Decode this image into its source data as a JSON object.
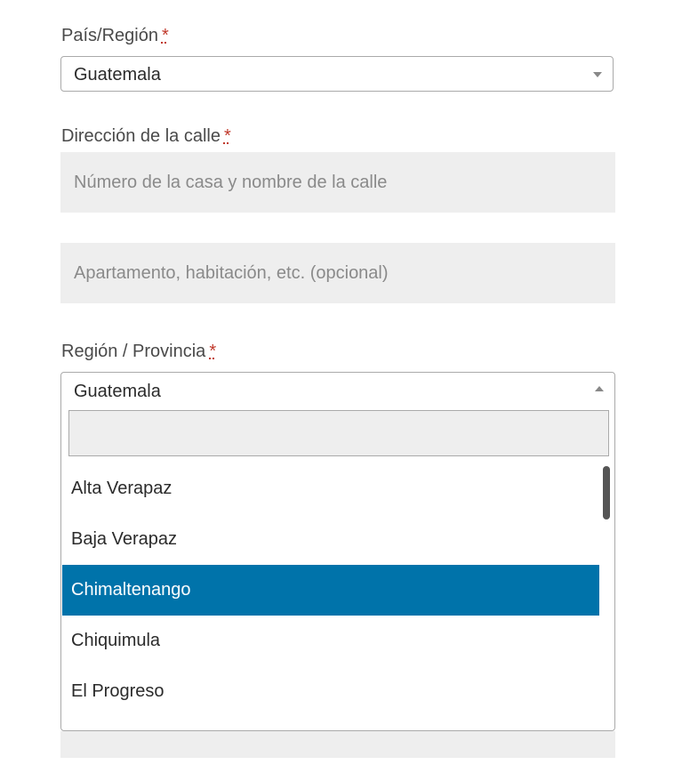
{
  "country": {
    "label": "País/Región",
    "required_mark": "*",
    "value": "Guatemala"
  },
  "street": {
    "label": "Dirección de la calle",
    "required_mark": "*",
    "line1_placeholder": "Número de la casa y nombre de la calle",
    "line2_placeholder": "Apartamento, habitación, etc. (opcional)"
  },
  "region": {
    "label": "Región / Provincia",
    "required_mark": "*",
    "value": "Guatemala",
    "search_value": "",
    "options": [
      {
        "label": "Alta Verapaz",
        "selected": false
      },
      {
        "label": "Baja Verapaz",
        "selected": false
      },
      {
        "label": "Chimaltenango",
        "selected": true
      },
      {
        "label": "Chiquimula",
        "selected": false
      },
      {
        "label": "El Progreso",
        "selected": false
      }
    ]
  },
  "colors": {
    "highlight": "#0073aa",
    "required": "#c0392b",
    "input_bg": "#eeeeee"
  },
  "icons": {
    "country_arrow": "chevron-down-icon",
    "region_arrow": "chevron-up-icon"
  }
}
